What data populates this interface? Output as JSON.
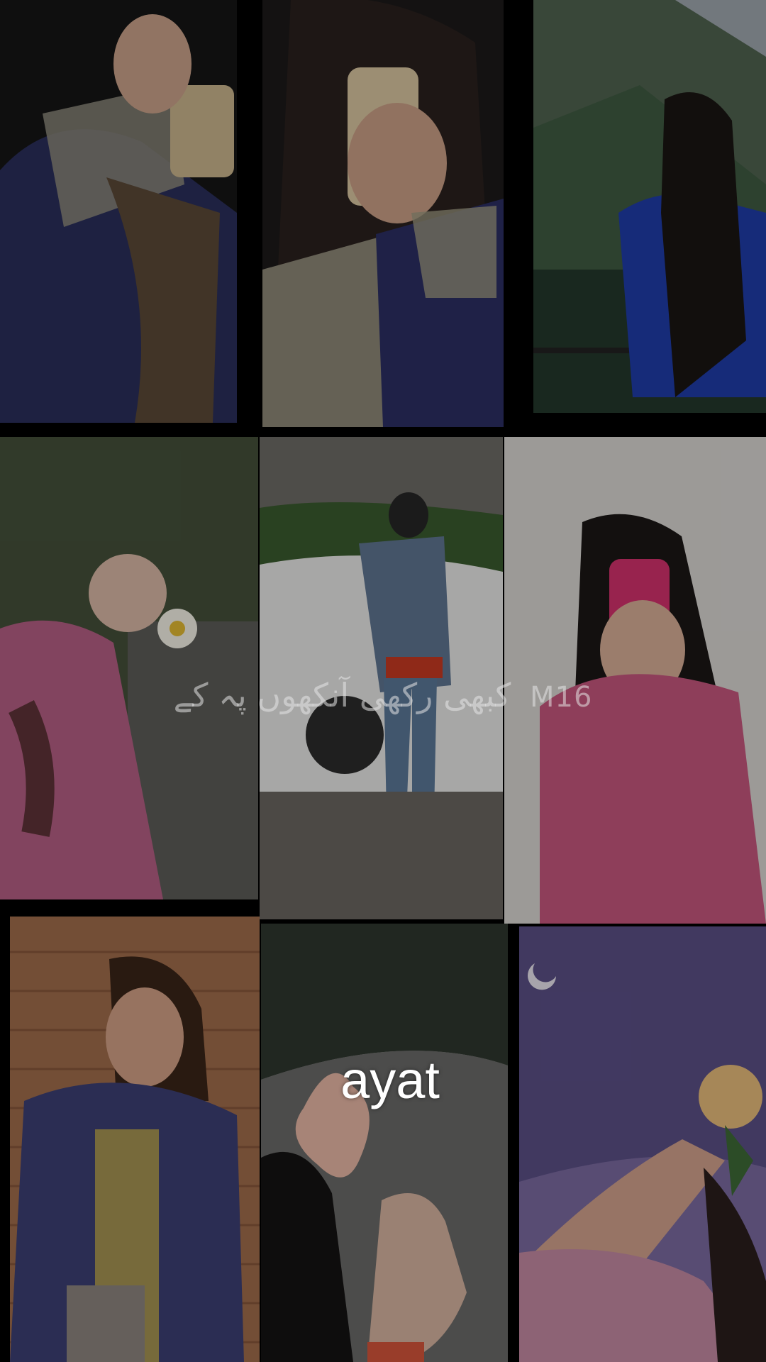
{
  "overlay": {
    "urdu_line": "کبھی رکھی آنکھوں پہ کے",
    "tag": "M16",
    "name": "ayat"
  },
  "photos": [
    {
      "name": "photo-mirror-selfie-left"
    },
    {
      "name": "photo-mirror-selfie-butterfly-case"
    },
    {
      "name": "photo-girl-mountain-view"
    },
    {
      "name": "photo-girl-holding-daisy"
    },
    {
      "name": "photo-girl-street-car"
    },
    {
      "name": "photo-pink-phone-selfie"
    },
    {
      "name": "photo-girl-denim-jacket-brick"
    },
    {
      "name": "photo-hand-holding-flower"
    },
    {
      "name": "photo-girl-with-rose-moon"
    }
  ]
}
